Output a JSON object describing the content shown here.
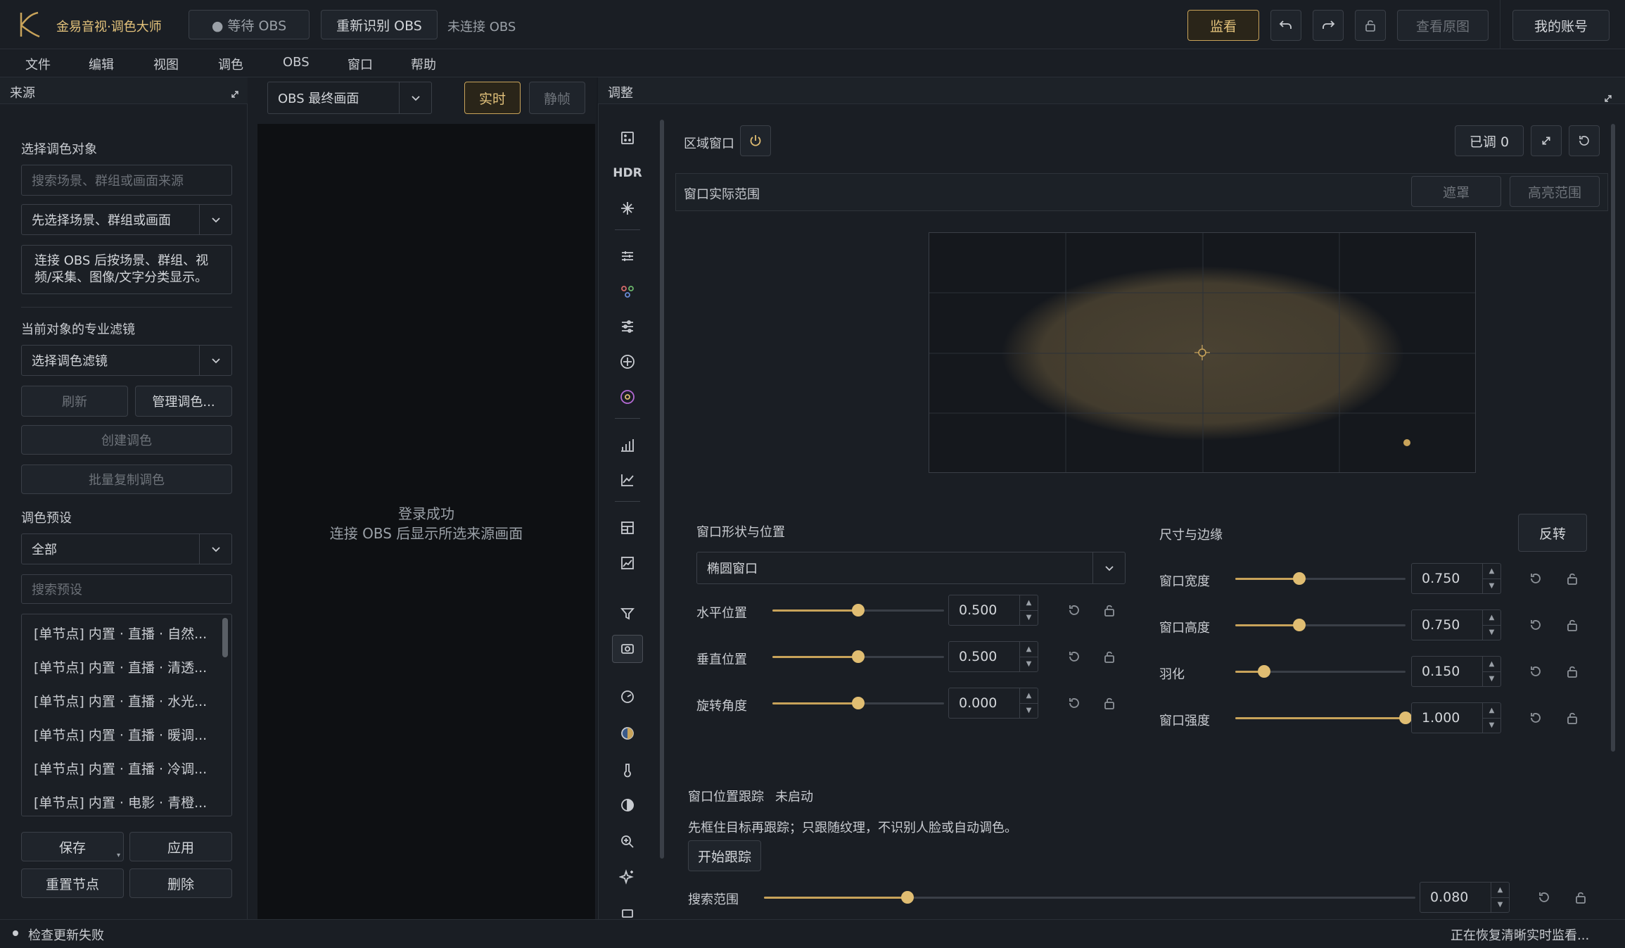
{
  "app": {
    "title": "金易音视·调色大师"
  },
  "topbar": {
    "obs_status": "● 等待 OBS",
    "reidentify": "重新识别 OBS",
    "connection": "未连接 OBS",
    "monitor": "监看",
    "view_original": "查看原图",
    "account": "我的账号"
  },
  "menu": [
    "文件",
    "编辑",
    "视图",
    "调色",
    "OBS",
    "窗口",
    "帮助"
  ],
  "source_panel": {
    "title": "来源",
    "select_target_label": "选择调色对象",
    "search_placeholder": "搜索场景、群组或画面来源",
    "scene_select": "先选择场景、群组或画面",
    "info": "连接 OBS 后按场景、群组、视频/采集、图像/文字分类显示。",
    "filter_label": "当前对象的专业滤镜",
    "filter_select": "选择调色滤镜",
    "refresh": "刷新",
    "manage": "管理调色...",
    "create": "创建调色",
    "batch_copy": "批量复制调色",
    "presets_label": "调色预设",
    "preset_category": "全部",
    "preset_search_placeholder": "搜索预设",
    "presets": [
      "[单节点] 内置 · 直播 · 自然...",
      "[单节点] 内置 · 直播 · 清透...",
      "[单节点] 内置 · 直播 · 水光...",
      "[单节点] 内置 · 直播 · 暖调...",
      "[单节点] 内置 · 直播 · 冷调...",
      "[单节点] 内置 · 电影 · 青橙..."
    ],
    "save": "保存",
    "apply": "应用",
    "reset_node": "重置节点",
    "delete": "删除"
  },
  "preview": {
    "source_select": "OBS 最终画面",
    "realtime": "实时",
    "still": "静帧",
    "msg_line1": "登录成功",
    "msg_line2": "连接 OBS 后显示所选来源画面"
  },
  "adjust_panel": {
    "title": "调整",
    "tools": [
      "mask-icon",
      "hdr-icon",
      "sparkle-icon",
      "sliders-icon",
      "nodes-icon",
      "tune-icon",
      "crosshair-icon",
      "color-wheel-icon",
      "bars-icon",
      "line-chart-icon",
      "grid-icon",
      "trend-icon",
      "filter-icon",
      "window-icon",
      "dial-icon",
      "sphere-icon",
      "thermometer-icon",
      "contrast-icon",
      "zoom-icon",
      "stars-icon",
      "rect-icon"
    ],
    "tools_hdr_text": "HDR",
    "region_window": "区域窗口",
    "adjusted": "已调 0",
    "window_range": "窗口实际范围",
    "mask": "遮罩",
    "highlight_range": "高亮范围",
    "shape_pos_label": "窗口形状与位置",
    "shape_select": "椭圆窗口",
    "size_edge_label": "尺寸与边缘",
    "invert": "反转",
    "left_params": [
      {
        "label": "水平位置",
        "value": "0.500",
        "level": 0.5
      },
      {
        "label": "垂直位置",
        "value": "0.500",
        "level": 0.5
      },
      {
        "label": "旋转角度",
        "value": "0.000",
        "level": 0.5
      }
    ],
    "right_params": [
      {
        "label": "窗口宽度",
        "value": "0.750",
        "level": 0.375
      },
      {
        "label": "窗口高度",
        "value": "0.750",
        "level": 0.375
      },
      {
        "label": "羽化",
        "value": "0.150",
        "level": 0.17
      },
      {
        "label": "窗口强度",
        "value": "1.000",
        "level": 1.0
      }
    ],
    "tracking_label": "窗口位置跟踪",
    "tracking_status": "未启动",
    "tracking_hint": "先框住目标再跟踪；只跟随纹理，不识别人脸或自动调色。",
    "start_tracking": "开始跟踪",
    "search_range_label": "搜索范围",
    "search_range_value": "0.080",
    "search_range_level": 0.22
  },
  "statusbar": {
    "left": "检查更新失败",
    "right": "正在恢复清晰实时监看..."
  },
  "colors": {
    "accent": "#c8a35a",
    "bg": "#171b21"
  }
}
